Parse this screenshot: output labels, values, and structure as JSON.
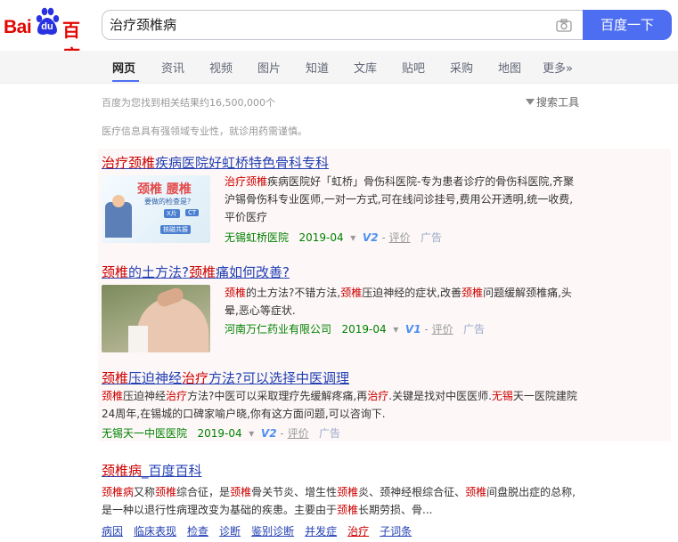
{
  "logo": {
    "part1": "Bai",
    "part2": "du",
    "part3": "百度"
  },
  "search": {
    "query": "治疗颈椎病",
    "button": "百度一下"
  },
  "tabs": [
    "网页",
    "资讯",
    "视频",
    "图片",
    "知道",
    "文库",
    "贴吧",
    "采购",
    "地图",
    "更多»"
  ],
  "stats": "百度为您找到相关结果约16,500,000个",
  "tools": "搜索工具",
  "notice": "医疗信息具有强领域专业性，就诊用药需谨慎。",
  "results": [
    {
      "title": [
        "治疗颈椎",
        "疾病医院好虹桥特色骨科专科"
      ],
      "desc": [
        "治疗颈椎",
        "疾病医院好「虹桥」骨伤科医院-专为患者诊疗的骨伤科医院,齐聚沪锡骨伤科专业医师,一对一方式,可在线问诊挂号,费用公开透明,统一收费,平价医疗"
      ],
      "thumb": {
        "t1": "颈椎 腰椎",
        "t2": "要做的检查是？",
        "b1": "X片",
        "b2": "CT",
        "b3": "核磁共振"
      },
      "site": "无锡虹桥医院",
      "date": "2019-04",
      "badge": "V2",
      "eval": "评价",
      "ad": "广告"
    },
    {
      "title": [
        "颈椎",
        "的土方法?",
        "颈椎",
        "痛如何改善?"
      ],
      "desc": [
        "颈椎",
        "的土方法?不错方法,",
        "颈椎",
        "压迫神经的症状,改善",
        "颈椎",
        "问题缓解颈椎痛,头晕,恶心等症状."
      ],
      "site": "河南万仁药业有限公司",
      "date": "2019-04",
      "badge": "V1",
      "eval": "评价",
      "ad": "广告"
    },
    {
      "title": [
        "颈椎",
        "压迫神经",
        "治疗",
        "方法?可以选择中医调理"
      ],
      "desc": [
        "颈椎",
        "压迫神经",
        "治疗",
        "方法?中医可以采取理疗先缓解疼痛,再",
        "治疗",
        ".关键是找对中医医师.",
        "无锡",
        "天一医院建院24周年,在锡城的口碑家喻户晓,你有这方面问题,可以咨询下."
      ],
      "site": "无锡天一中医医院",
      "date": "2019-04",
      "badge": "V2",
      "eval": "评价",
      "ad": "广告"
    },
    {
      "title": [
        "颈椎病",
        "_百度百科"
      ],
      "desc": [
        "颈椎病",
        "又称",
        "颈椎",
        "综合征，是",
        "颈椎",
        "骨关节炎、增生性",
        "颈椎",
        "炎、颈神经根综合征、",
        "颈椎",
        "间盘脱出症的总称,是一种以退行性病理改变为基础的疾患。主要由于",
        "颈椎",
        "长期劳损、骨..."
      ],
      "links": [
        "病因",
        "临床表现",
        "检查",
        "诊断",
        "鉴别诊断",
        "并发症",
        "治疗",
        "子词条"
      ]
    }
  ],
  "colors": {
    "accent": "#4e6ef2",
    "link": "#2440b3",
    "highlight": "#cc0000",
    "site": "#008000"
  }
}
